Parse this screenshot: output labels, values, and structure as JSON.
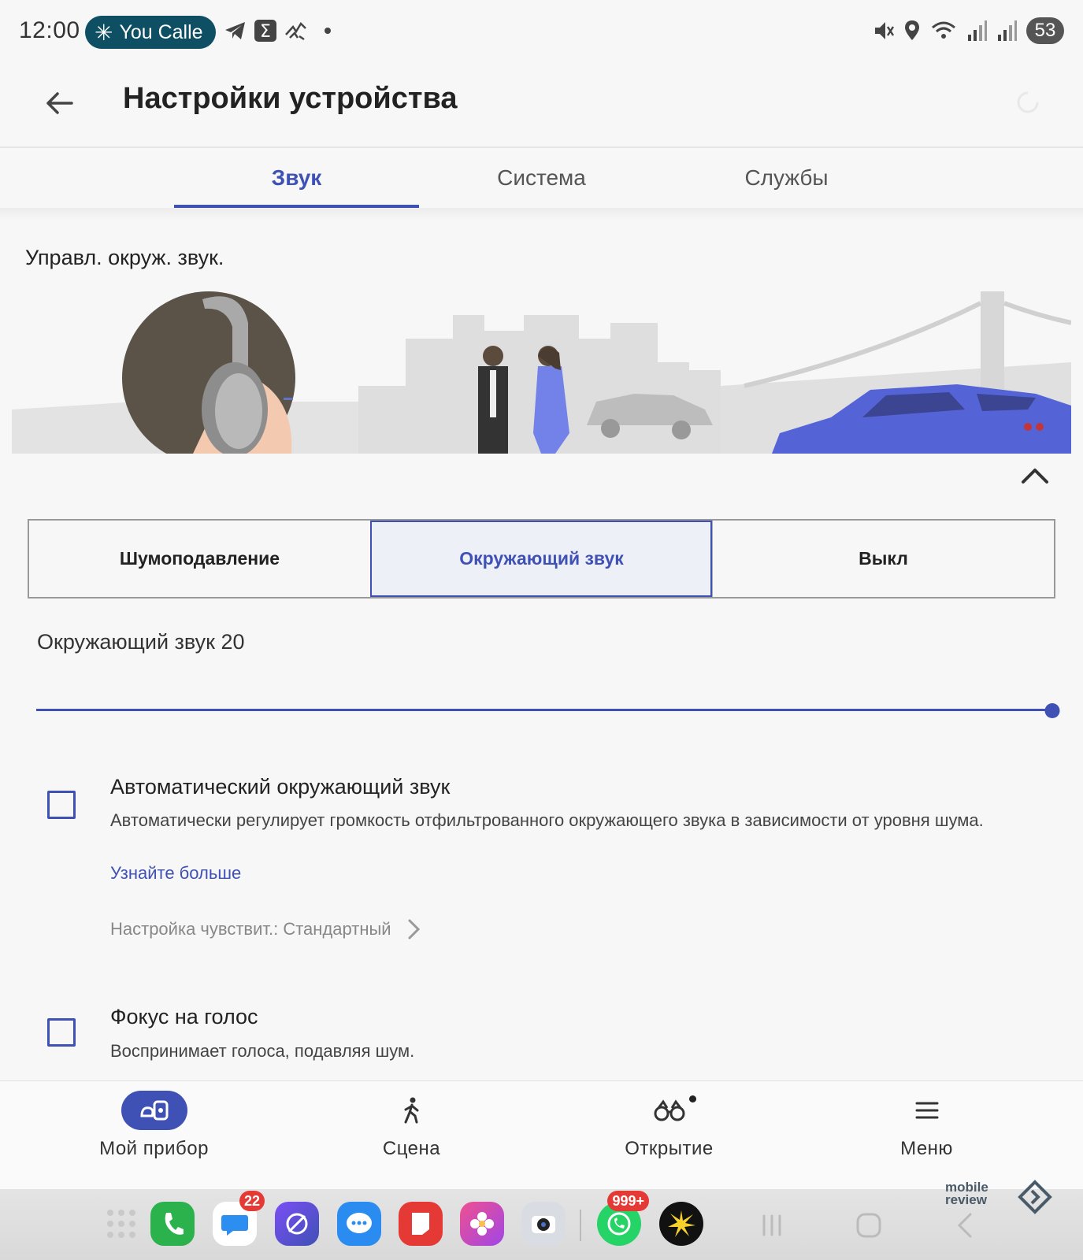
{
  "status_bar": {
    "time": "12:00",
    "call_pill": "You Calle",
    "battery": "53",
    "icons": [
      "telegram-icon",
      "sigma-icon",
      "bird-icon",
      "dot",
      "mute-icon",
      "location-icon",
      "wifi-icon",
      "signal-icon",
      "signal-icon"
    ]
  },
  "app_bar": {
    "title": "Настройки устройства"
  },
  "tabs": [
    {
      "label": "Звук",
      "active": true
    },
    {
      "label": "Система",
      "active": false
    },
    {
      "label": "Службы",
      "active": false
    }
  ],
  "ambient": {
    "section_title": "Управл. окруж. звук.",
    "modes": [
      {
        "label": "Шумоподавление",
        "active": false
      },
      {
        "label": "Окружающий звук",
        "active": true
      },
      {
        "label": "Выкл",
        "active": false
      }
    ],
    "level_label": "Окружающий звук 20",
    "level": 20,
    "level_max": 20
  },
  "options": {
    "auto": {
      "title": "Автоматический окружающий звук",
      "description": "Автоматически регулирует громкость отфильтрованного окружающего звука в зависимости от уровня шума.",
      "learn_more": "Узнайте больше",
      "sensitivity": "Настройка чувствит.: Стандартный",
      "checked": false
    },
    "voice_focus": {
      "title": "Фокус на голос",
      "description": "Воспринимает голоса, подавляя шум.",
      "checked": false
    }
  },
  "bottom_nav": [
    {
      "label": "Мой прибор",
      "icon": "earbuds-icon",
      "active": true
    },
    {
      "label": "Сцена",
      "icon": "walking-person-icon",
      "active": false
    },
    {
      "label": "Открытие",
      "icon": "binoculars-icon",
      "active": false
    },
    {
      "label": "Меню",
      "icon": "hamburger-menu-icon",
      "active": false
    }
  ],
  "dock": {
    "messages_badge": "22",
    "whatsapp_badge": "999+"
  },
  "watermark": "mobile review",
  "colors": {
    "accent": "#3f51b5",
    "background": "#f7f7f7",
    "pill": "#0f4f63"
  }
}
